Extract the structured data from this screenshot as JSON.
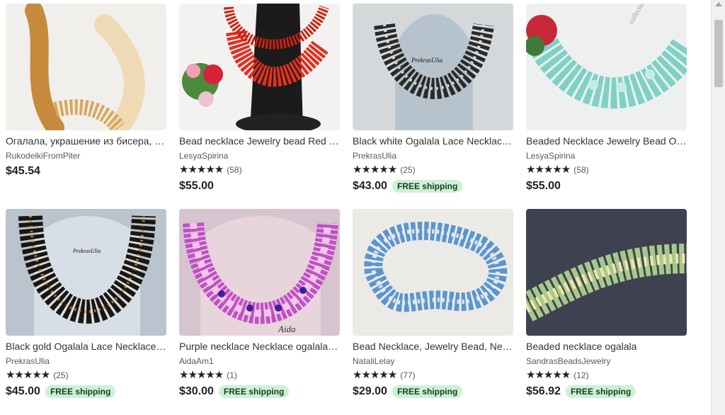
{
  "listings": [
    {
      "title": "Огалала, украшение из бисера, о...",
      "shop": "RukodelkiFromPiter",
      "stars": "",
      "reviews": "",
      "price": "$45.54",
      "free_shipping": ""
    },
    {
      "title": "Bead necklace Jewelry bead Red n...",
      "shop": "LesyaSpirina",
      "stars": "★★★★★",
      "reviews": "(58)",
      "price": "$55.00",
      "free_shipping": ""
    },
    {
      "title": "Black white Ogalala Lace Necklace ...",
      "shop": "PrekrasUlia",
      "stars": "★★★★★",
      "reviews": "(25)",
      "price": "$43.00",
      "free_shipping": "FREE shipping"
    },
    {
      "title": "Beaded Necklace Jewelry Bead Og...",
      "shop": "LesyaSpirina",
      "stars": "★★★★★",
      "reviews": "(58)",
      "price": "$55.00",
      "free_shipping": ""
    },
    {
      "title": "Black gold Ogalala Lace Necklace g...",
      "shop": "PrekrasUlia",
      "stars": "★★★★★",
      "reviews": "(25)",
      "price": "$45.00",
      "free_shipping": "FREE shipping"
    },
    {
      "title": "Purple necklace Necklace ogalala H...",
      "shop": "AidaAm1",
      "stars": "★★★★★",
      "reviews": "(1)",
      "price": "$30.00",
      "free_shipping": "FREE shipping"
    },
    {
      "title": "Bead Necklace, Jewelry Bead, Neck...",
      "shop": "NataliLelay",
      "stars": "★★★★★",
      "reviews": "(77)",
      "price": "$29.00",
      "free_shipping": "FREE shipping"
    },
    {
      "title": "Beaded necklace ogalala",
      "shop": "SandrasBeadsJewelry",
      "stars": "★★★★★",
      "reviews": "(12)",
      "price": "$56.92",
      "free_shipping": "FREE shipping"
    }
  ],
  "image_text": {
    "brand_prekras": "PrekrasUlia",
    "brand_aida": "Aida",
    "watermark": "collection"
  },
  "colors": {
    "free_shipping_bg": "#cdf1d4",
    "free_shipping_text": "#1a3b22"
  }
}
